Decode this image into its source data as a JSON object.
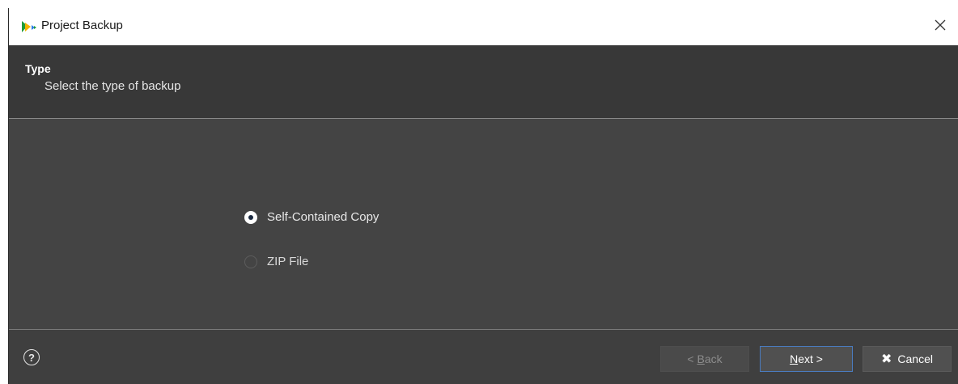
{
  "window": {
    "title": "Project Backup",
    "app_icon": "app-logo-icon",
    "close_icon": "close-icon"
  },
  "header": {
    "title": "Type",
    "subtitle": "Select the type of backup"
  },
  "options": [
    {
      "label": "Self-Contained Copy",
      "selected": true
    },
    {
      "label": "ZIP File",
      "selected": false
    }
  ],
  "footer": {
    "help_label": "?",
    "back": {
      "prefix": "< ",
      "mnemonic": "B",
      "rest": "ack",
      "enabled": false
    },
    "next": {
      "mnemonic": "N",
      "rest": "ext >",
      "enabled": true
    },
    "cancel": {
      "icon": "✖",
      "label": "Cancel",
      "enabled": true
    }
  },
  "colors": {
    "dialog_bg": "#444444",
    "header_bg": "#383838",
    "footer_bg": "#3f3f3f",
    "focus_border": "#4a7cc0",
    "disabled_text": "#8c8c8c"
  }
}
